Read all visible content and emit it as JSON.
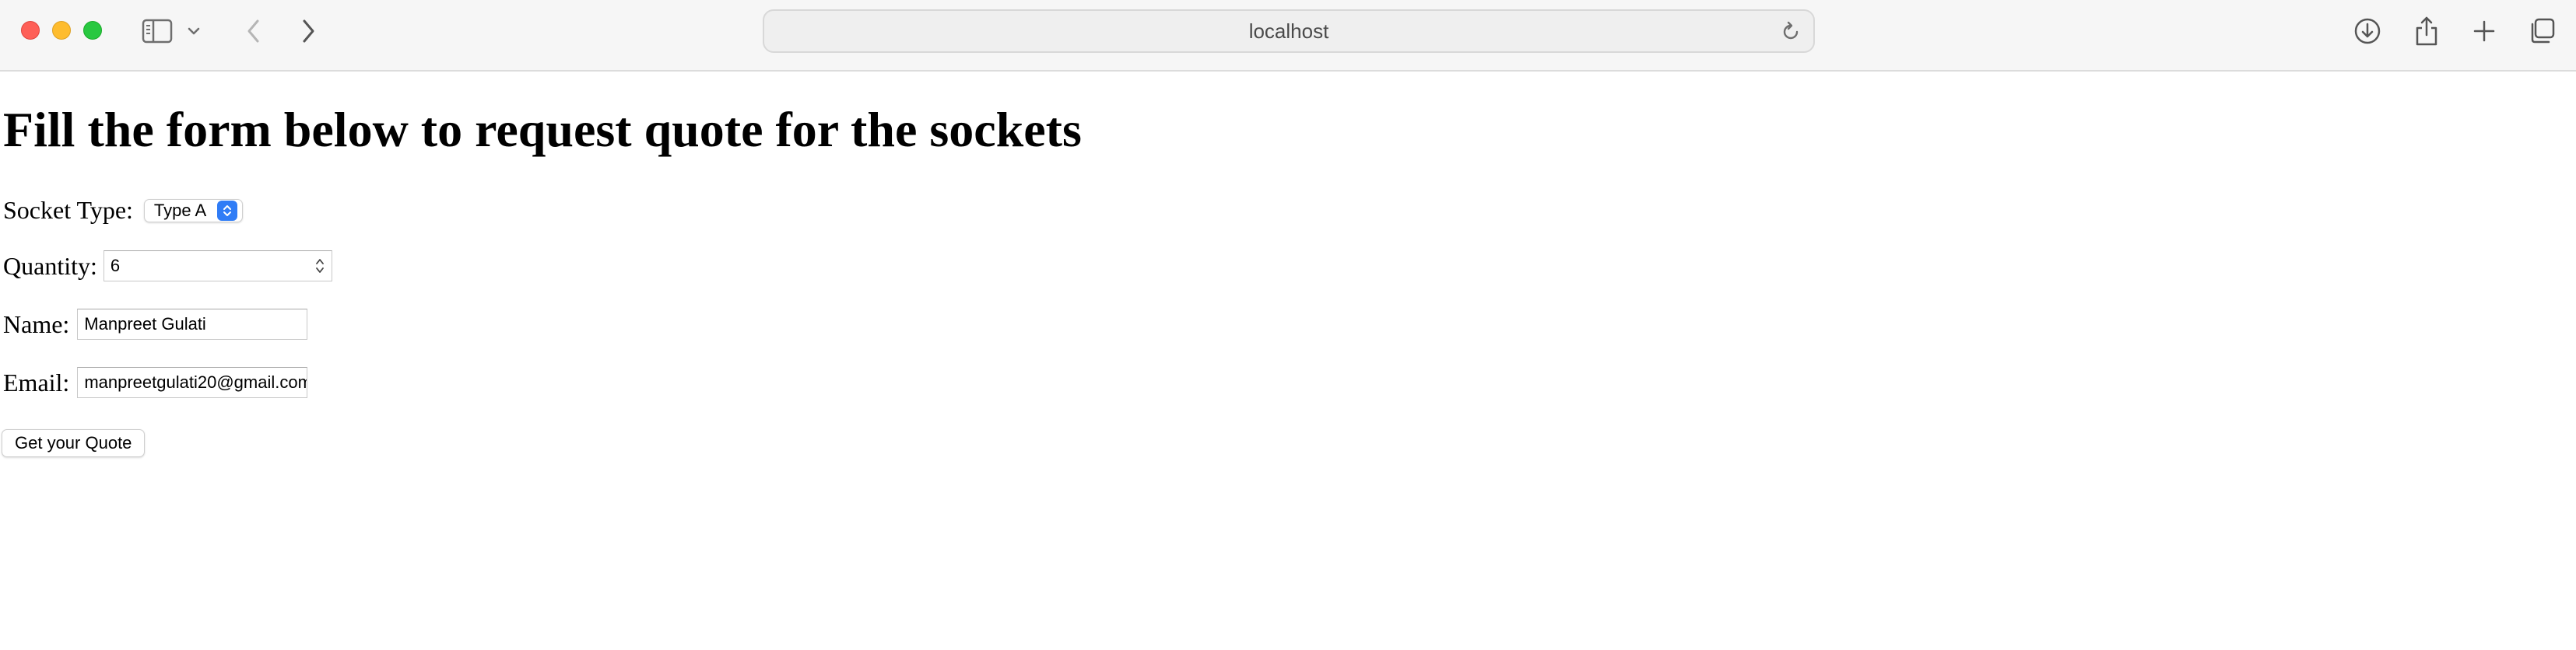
{
  "browser": {
    "url": "localhost",
    "icons": {
      "sidebar": "sidebar-icon",
      "sidebar_menu": "chevron-down-icon",
      "back": "chevron-left-icon",
      "forward": "chevron-right-icon",
      "reload": "reload-icon",
      "downloads": "download-icon",
      "share": "share-icon",
      "new_tab": "plus-icon",
      "tabs": "tab-overview-icon"
    },
    "colors": {
      "close": "#fe5f57",
      "minimize": "#febc2e",
      "maximize": "#28c840"
    }
  },
  "page": {
    "heading": "Fill the form below to request quote for the sockets",
    "form": {
      "socket_type": {
        "label": "Socket Type:",
        "value": "Type A"
      },
      "quantity": {
        "label": "Quantity:",
        "value": "6"
      },
      "name": {
        "label": "Name:",
        "value": "Manpreet Gulati"
      },
      "email": {
        "label": "Email:",
        "value": "manpreetgulati20@gmail.com"
      },
      "submit_label": "Get your Quote"
    },
    "accent_color": "#2f7cf6"
  }
}
